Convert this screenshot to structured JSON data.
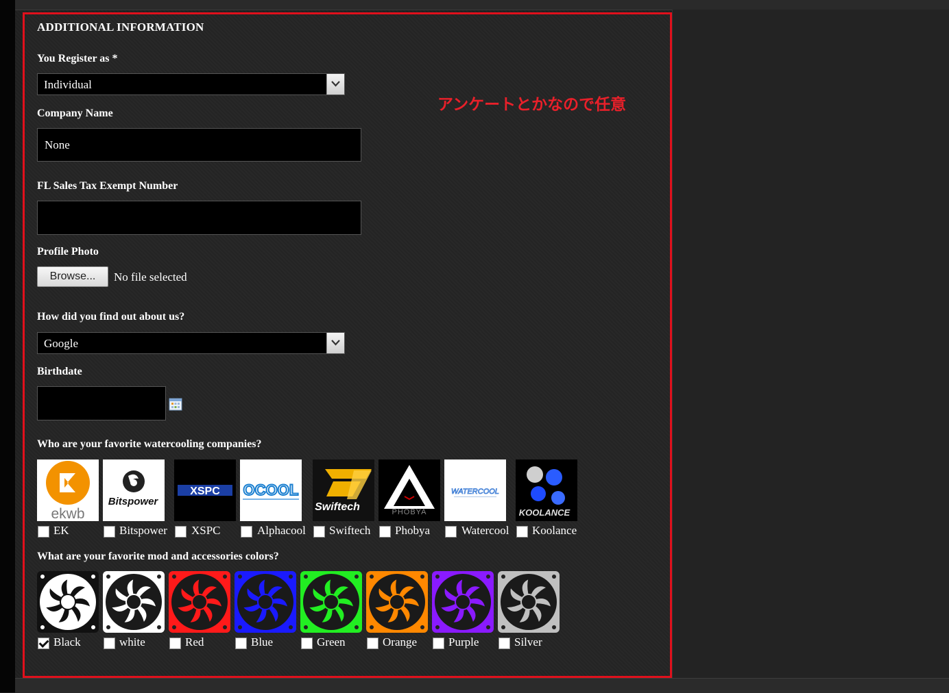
{
  "section_title": "ADDITIONAL INFORMATION",
  "annotation": "アンケートとかなので任意",
  "register_as": {
    "label": "You Register as *",
    "value": "Individual"
  },
  "company_name": {
    "label": "Company Name",
    "value": "None"
  },
  "tax_exempt": {
    "label": "FL Sales Tax Exempt Number",
    "value": ""
  },
  "profile_photo": {
    "label": "Profile Photo",
    "button": "Browse...",
    "status": "No file selected"
  },
  "find_out": {
    "label": "How did you find out about us?",
    "value": "Google"
  },
  "birthdate": {
    "label": "Birthdate",
    "value": ""
  },
  "companies": {
    "label": "Who are your favorite watercooling companies?",
    "items": [
      {
        "name": "EK",
        "logo_text": "ekwb",
        "checked": false
      },
      {
        "name": "Bitspower",
        "logo_text": "Bitspower",
        "checked": false
      },
      {
        "name": "XSPC",
        "logo_text": "XSPC",
        "checked": false
      },
      {
        "name": "Alphacool",
        "logo_text": "OCOOL",
        "checked": false
      },
      {
        "name": "Swiftech",
        "logo_text": "Swiftech",
        "checked": false
      },
      {
        "name": "Phobya",
        "logo_text": "PHOBYA",
        "checked": false
      },
      {
        "name": "Watercool",
        "logo_text": "WATERCOOL",
        "checked": false
      },
      {
        "name": "Koolance",
        "logo_text": "KOOLANCE",
        "checked": false
      }
    ]
  },
  "colors": {
    "label": "What are your favorite mod and accessories colors?",
    "items": [
      {
        "name": "Black",
        "hex": "#111111",
        "blade": "#ffffff",
        "checked": true
      },
      {
        "name": "white",
        "hex": "#ffffff",
        "blade": "#ffffff",
        "checked": false
      },
      {
        "name": "Red",
        "hex": "#ff1a1a",
        "blade": "#ff1a1a",
        "checked": false
      },
      {
        "name": "Blue",
        "hex": "#1a1aff",
        "blade": "#1a1aff",
        "checked": false
      },
      {
        "name": "Green",
        "hex": "#22ee22",
        "blade": "#22ee22",
        "checked": false
      },
      {
        "name": "Orange",
        "hex": "#ff8800",
        "blade": "#ff8800",
        "checked": false
      },
      {
        "name": "Purple",
        "hex": "#8a1aff",
        "blade": "#8a1aff",
        "checked": false
      },
      {
        "name": "Silver",
        "hex": "#c0c0c0",
        "blade": "#c0c0c0",
        "checked": false
      }
    ]
  }
}
